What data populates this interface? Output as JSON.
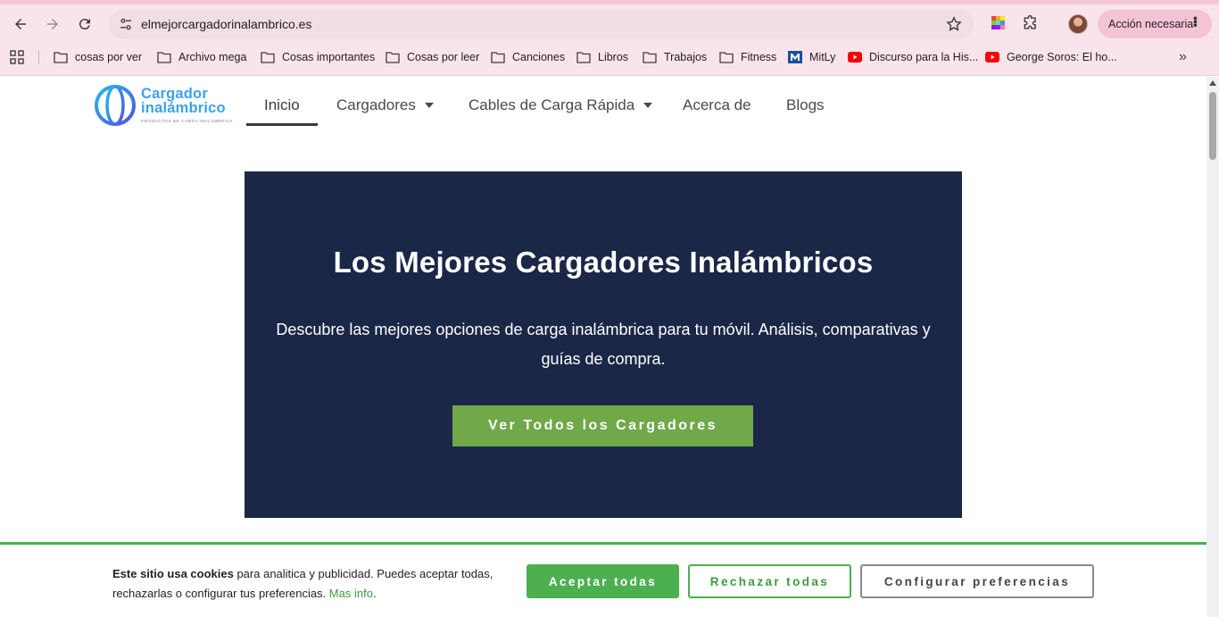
{
  "browser": {
    "url": "elmejorcargadorinalambrico.es",
    "action_label": "Acción necesaria",
    "bookmarks": [
      {
        "label": "cosas por ver",
        "icon": "folder-icon"
      },
      {
        "label": "Archivo mega",
        "icon": "folder-icon"
      },
      {
        "label": "Cosas importantes",
        "icon": "folder-icon"
      },
      {
        "label": "Cosas por leer",
        "icon": "folder-icon"
      },
      {
        "label": "Canciones",
        "icon": "folder-icon"
      },
      {
        "label": "Libros",
        "icon": "folder-icon"
      },
      {
        "label": "Trabajos",
        "icon": "folder-icon"
      },
      {
        "label": "Fitness",
        "icon": "folder-icon"
      },
      {
        "label": "MitLy",
        "icon": "mitly-icon"
      },
      {
        "label": "Discurso para la His...",
        "icon": "youtube-icon"
      },
      {
        "label": "George Soros: El ho...",
        "icon": "youtube-icon"
      }
    ]
  },
  "site": {
    "logo_line1": "Cargador",
    "logo_line2": "inalámbrico",
    "logo_tagline": "PRODUCTOS DE CARGA INALÁMBRICA",
    "menu": [
      {
        "label": "Inicio",
        "active": true,
        "dropdown": false
      },
      {
        "label": "Cargadores",
        "active": false,
        "dropdown": true
      },
      {
        "label": "Cables de Carga Rápida",
        "active": false,
        "dropdown": true
      },
      {
        "label": "Acerca de",
        "active": false,
        "dropdown": false
      },
      {
        "label": "Blogs",
        "active": false,
        "dropdown": false
      }
    ]
  },
  "hero": {
    "title": "Los Mejores Cargadores Inalámbricos",
    "description": "Descubre las mejores opciones de carga inalámbrica para tu móvil. Análisis, comparativas y guías de compra.",
    "cta": "Ver Todos los Cargadores"
  },
  "cookie": {
    "bold": "Este sitio usa cookies",
    "text": " para analitica y publicidad. Puedes aceptar todas, rechazarlas o configurar tus preferencias. ",
    "more": "Mas info",
    "end": ".",
    "accept": "Aceptar todas",
    "reject": "Rechazar todas",
    "configure": "Configurar preferencias"
  },
  "colors": {
    "hero_bg": "#1b2747",
    "cta_green": "#70a84a",
    "cookie_green": "#4caf50",
    "logo_blue": "#3aa3ea"
  }
}
